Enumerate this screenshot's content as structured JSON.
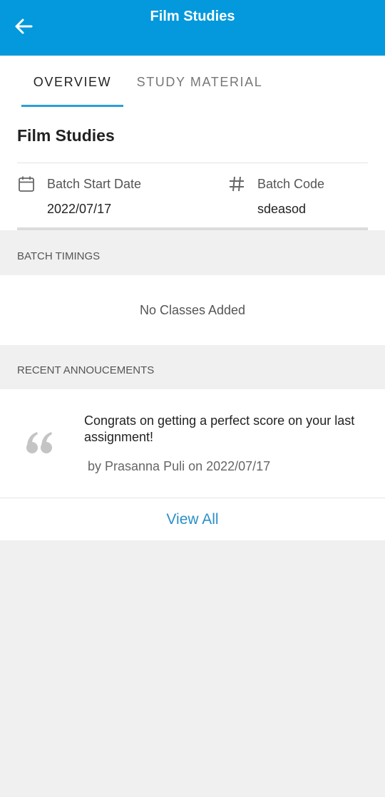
{
  "appbar": {
    "title": "Film Studies",
    "back_icon": "arrow-left-icon",
    "background": "#0399dc"
  },
  "tabs": [
    {
      "label": "OVERVIEW",
      "selected": true
    },
    {
      "label": "STUDY MATERIAL",
      "selected": false
    }
  ],
  "course": {
    "title": "Film Studies",
    "batch_start_label": "Batch Start Date",
    "batch_start_value": "2022/07/17",
    "batch_start_icon": "calendar-icon",
    "batch_code_label": "Batch Code",
    "batch_code_value": "sdeasod",
    "batch_code_icon": "hash-icon"
  },
  "batch_timings": {
    "header": "BATCH TIMINGS",
    "empty_text": "No Classes Added"
  },
  "announcements": {
    "header": "RECENT ANNOUCEMENTS",
    "items": [
      {
        "text": "Congrats on getting a perfect score on your last assignment!",
        "meta": "by Prasanna Puli on 2022/07/17",
        "icon": "quote-icon"
      }
    ],
    "view_all_label": "View All"
  },
  "colors": {
    "accent": "#2a9fd6",
    "link": "#2a8fc8"
  }
}
